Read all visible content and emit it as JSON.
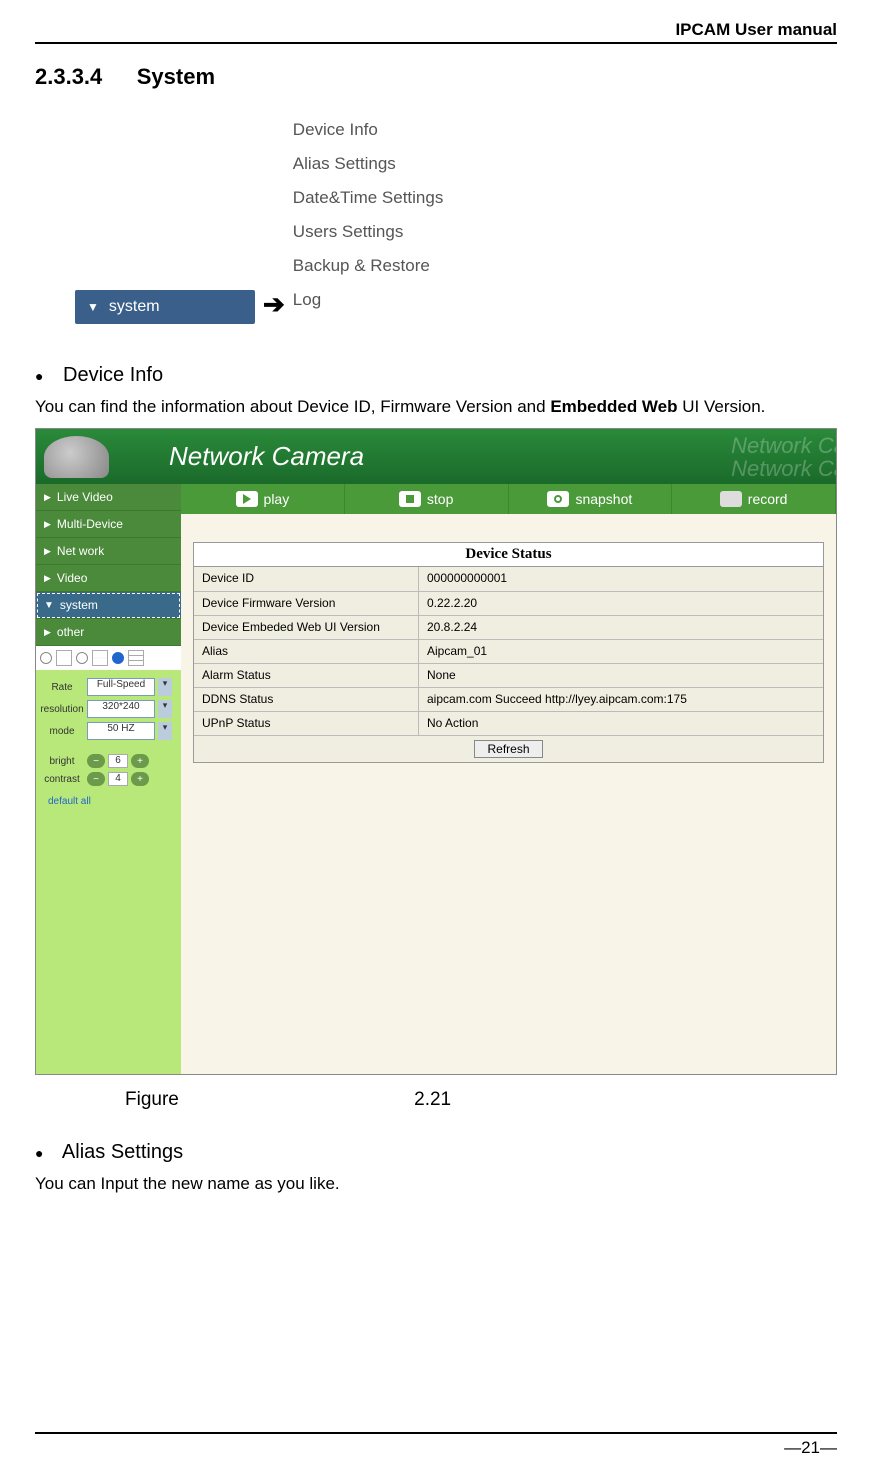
{
  "page": {
    "header": "IPCAM User manual",
    "section_number": "2.3.3.4",
    "section_title": "System",
    "page_number": "—21—"
  },
  "menu_diagram": {
    "button_label": "system",
    "arrow": "➔",
    "items": [
      "Device Info",
      "Alias Settings",
      "Date&Time Settings",
      "Users Settings",
      "Backup & Restore",
      "Log"
    ]
  },
  "device_info_section": {
    "heading": "Device Info",
    "para_pre": "You can find the information about Device ID, Firmware Version and ",
    "para_bold": "Embedded Web",
    "para_post": " UI Version."
  },
  "figure": {
    "title": "Network Camera",
    "ghost": "Network Ca",
    "nav": [
      "Live Video",
      "Multi-Device",
      "Net work",
      "Video",
      "system",
      "other"
    ],
    "toolbar": [
      "play",
      "stop",
      "snapshot",
      "record"
    ],
    "controls": {
      "rate_label": "Rate",
      "rate_value": "Full-Speed",
      "resolution_label": "resolution",
      "resolution_value": "320*240",
      "mode_label": "mode",
      "mode_value": "50 HZ",
      "bright_label": "bright",
      "bright_value": "6",
      "contrast_label": "contrast",
      "contrast_value": "4",
      "default_link": "default all"
    },
    "status": {
      "title": "Device Status",
      "rows": [
        {
          "label": "Device ID",
          "value": "000000000001"
        },
        {
          "label": "Device Firmware Version",
          "value": "0.22.2.20"
        },
        {
          "label": "Device Embeded Web UI Version",
          "value": "20.8.2.24"
        },
        {
          "label": "Alias",
          "value": "Aipcam_01"
        },
        {
          "label": "Alarm Status",
          "value": "None"
        },
        {
          "label": "DDNS Status",
          "value": "aipcam.com  Succeed  http://lyey.aipcam.com:175"
        },
        {
          "label": "UPnP Status",
          "value": "No Action"
        }
      ],
      "refresh": "Refresh"
    },
    "caption_label": "Figure",
    "caption_number": "2.21"
  },
  "alias_section": {
    "heading": "Alias Settings",
    "para": "You can Input the new name as you like."
  }
}
